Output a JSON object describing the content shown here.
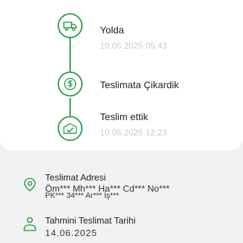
{
  "timeline": {
    "steps": [
      {
        "title": "Yolda",
        "date": "10.05.2025 05:43",
        "icon": "delivery-truck-icon"
      },
      {
        "title": "Teslimata Çikardik",
        "icon": "dollar-coin-icon"
      },
      {
        "title": "Teslim ettik",
        "date": "10.05.2025 12:23",
        "icon": "delivered-check-icon"
      }
    ]
  },
  "delivery_address": {
    "label": "Teslimat Adresi",
    "line1": "Öm*** Mh*** Ha*** Cd*** No***",
    "line2": "PK*** 34*** Ar*** İş***",
    "icon": "location-pin-icon"
  },
  "estimated_delivery": {
    "label": "Tahmini Teslimat Tarihi",
    "value": "14.06.2025",
    "icon": "person-icon"
  },
  "colors": {
    "accent": "#2e9e4a",
    "muted_text": "#c8c8c8",
    "background": "#f2f2f2"
  }
}
